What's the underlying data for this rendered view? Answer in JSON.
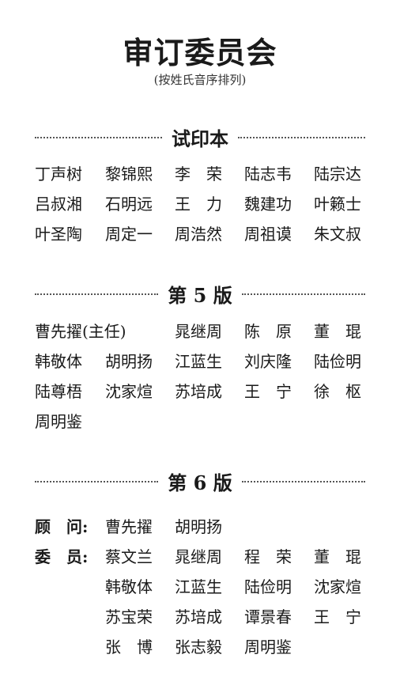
{
  "title": "审订委员会",
  "subtitle": "(按姓氏音序排列)",
  "sections": [
    {
      "heading": "试印本",
      "rows": [
        [
          "丁声树",
          "黎锦熙",
          "李　荣",
          "陆志韦",
          "陆宗达"
        ],
        [
          "吕叔湘",
          "石明远",
          "王　力",
          "魏建功",
          "叶籁士"
        ],
        [
          "叶圣陶",
          "周定一",
          "周浩然",
          "周祖谟",
          "朱文叔"
        ]
      ]
    },
    {
      "heading": "第 5 版",
      "rows": [
        [
          "曹先擢(主任)",
          "晁继周",
          "陈　原",
          "董　琨"
        ],
        [
          "韩敬体",
          "胡明扬",
          "江蓝生",
          "刘庆隆",
          "陆俭明"
        ],
        [
          "陆尊梧",
          "沈家煊",
          "苏培成",
          "王　宁",
          "徐　枢"
        ],
        [
          "周明鉴"
        ]
      ]
    },
    {
      "heading": "第 6 版",
      "advisors_label": "顾　问:",
      "advisors": [
        "曹先擢",
        "胡明扬"
      ],
      "members_label": "委　员:",
      "members_rows": [
        [
          "蔡文兰",
          "晁继周",
          "程　荣",
          "董　琨"
        ],
        [
          "韩敬体",
          "江蓝生",
          "陆俭明",
          "沈家煊"
        ],
        [
          "苏宝荣",
          "苏培成",
          "谭景春",
          "王　宁"
        ],
        [
          "张　博",
          "张志毅",
          "周明鉴"
        ]
      ]
    }
  ]
}
